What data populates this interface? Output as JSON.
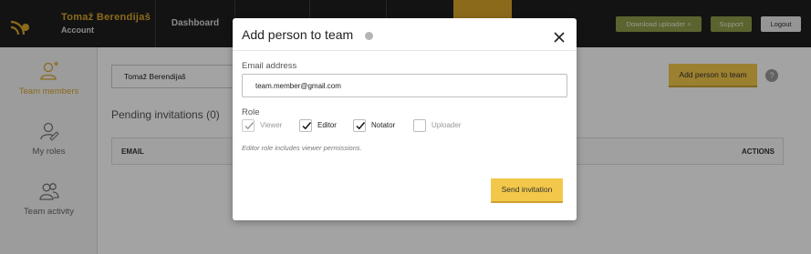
{
  "header": {
    "user_name": "Tomaž Berendijaš",
    "account_label": "Account",
    "nav": [
      {
        "label": "Dashboard"
      }
    ],
    "download_label": "Download uploader ⩡",
    "support_label": "Support",
    "logout_label": "Logout",
    "accent_color": "#d9a62b"
  },
  "sidebar": {
    "items": [
      {
        "label": "Team members",
        "icon": "user-add-icon",
        "active": true
      },
      {
        "label": "My roles",
        "icon": "user-edit-icon",
        "active": false
      },
      {
        "label": "Team activity",
        "icon": "users-icon",
        "active": false
      }
    ]
  },
  "main": {
    "team_select_value": "Tomaž Berendijaš",
    "add_person_label": "Add person to team",
    "pending_label": "Pending invitations (0)",
    "table_headers": [
      "EMAIL",
      "ACTIONS"
    ]
  },
  "modal": {
    "title": "Add person to team",
    "email_label": "Email address",
    "email_value": "team.member@gmail.com",
    "role_label": "Role",
    "roles": [
      {
        "label": "Viewer",
        "checked": true,
        "disabled": true
      },
      {
        "label": "Editor",
        "checked": true,
        "disabled": false
      },
      {
        "label": "Notator",
        "checked": true,
        "disabled": false
      },
      {
        "label": "Uploader",
        "checked": false,
        "disabled": false
      }
    ],
    "note": "Editor role includes viewer permissions.",
    "submit_label": "Send invitation"
  }
}
